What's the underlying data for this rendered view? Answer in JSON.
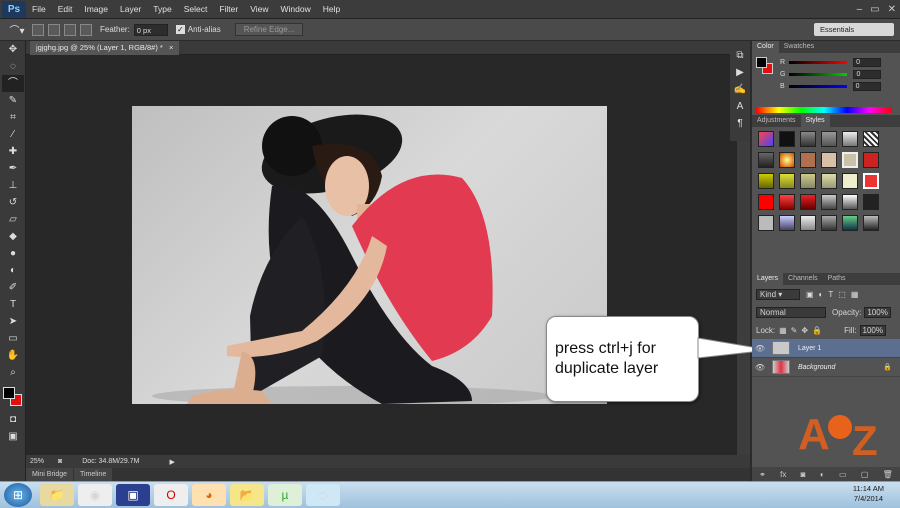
{
  "menubar": {
    "logo": "Ps",
    "items": [
      "File",
      "Edit",
      "Image",
      "Layer",
      "Type",
      "Select",
      "Filter",
      "View",
      "Window",
      "Help"
    ]
  },
  "options": {
    "feather_label": "Feather:",
    "feather_value": "0 px",
    "antialias_label": "Anti-alias",
    "refine_edge": "Refine Edge...",
    "workspace": "Essentials"
  },
  "document": {
    "tab_title": "jgjghg.jpg @ 25% (Layer 1, RGB/8#) *",
    "zoom": "25%",
    "doc_size": "Doc: 34.8M/29.7M"
  },
  "bottom_tabs": [
    "Mini Bridge",
    "Timeline"
  ],
  "color_panel": {
    "tabs": [
      "Color",
      "Swatches"
    ],
    "r_label": "R",
    "r_value": "0",
    "g_label": "G",
    "g_value": "0",
    "b_label": "B",
    "b_value": "0"
  },
  "styles_panel": {
    "tabs": [
      "Adjustments",
      "Styles"
    ]
  },
  "layers_panel": {
    "tabs": [
      "Layers",
      "Channels",
      "Paths"
    ],
    "kind_label": "Kind",
    "blend_mode": "Normal",
    "opacity_label": "Opacity:",
    "opacity_value": "100%",
    "lock_label": "Lock:",
    "fill_label": "Fill:",
    "fill_value": "100%",
    "layers": [
      {
        "name": "Layer 1"
      },
      {
        "name": "Background"
      }
    ]
  },
  "callout": {
    "line1": "press ctrl+j for",
    "line2": "duplicate layer"
  },
  "taskbar": {
    "time": "11:14 AM",
    "date": "7/4/2014"
  }
}
